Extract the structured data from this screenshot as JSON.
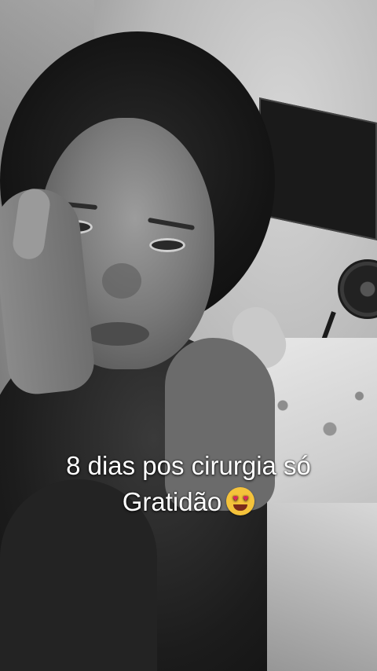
{
  "caption": {
    "line1": "8 dias pos cirurgia só",
    "line2": "Gratidão",
    "emoji_icon": "smiling-face-with-heart-eyes"
  }
}
